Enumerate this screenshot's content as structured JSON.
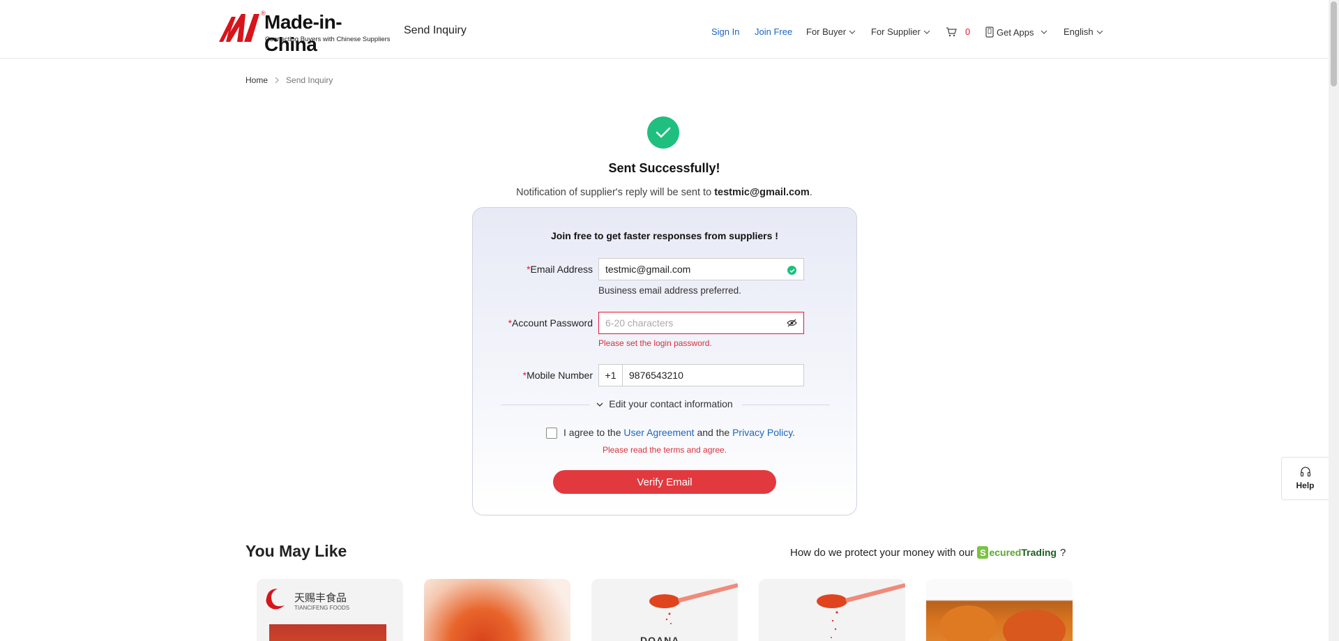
{
  "header": {
    "logo_text": "Made-in-China",
    "logo_reg": "®",
    "logo_tagline": "Connecting Buyers with Chinese Suppliers",
    "title": "Send Inquiry",
    "nav": {
      "sign_in": "Sign In",
      "join_free": "Join Free",
      "for_buyer": "For Buyer",
      "for_supplier": "For Supplier",
      "cart_count": "0",
      "get_apps": "Get Apps",
      "language": "English"
    }
  },
  "breadcrumb": {
    "home": "Home",
    "current": "Send Inquiry"
  },
  "success": {
    "title": "Sent Successfully!",
    "notify_prefix": "Notification of supplier's reply will be sent to ",
    "notify_email": "testmic@gmail.com",
    "notify_suffix": "."
  },
  "form": {
    "title": "Join free to get faster responses from suppliers !",
    "email_label": "Email Address",
    "email_value": "testmic@gmail.com",
    "email_hint": "Business email address preferred.",
    "password_label": "Account Password",
    "password_placeholder": "6-20 characters",
    "password_error": "Please set the login password.",
    "mobile_label": "Mobile Number",
    "country_code": "+1",
    "mobile_value": "9876543210",
    "edit_contact": "Edit your contact information",
    "agree_prefix": "I agree to the ",
    "user_agreement": "User Agreement",
    "agree_mid": " and the ",
    "privacy_policy": "Privacy Policy.",
    "agree_error": "Please read the terms and agree.",
    "verify_button": "Verify Email",
    "required_mark": "*"
  },
  "help": {
    "label": "Help"
  },
  "you_may_like": {
    "title": "You May Like",
    "protect_prefix": "How do we protect your money with our",
    "secured_s": "S",
    "secured_rest": "ecured",
    "trading": "Trading",
    "protect_suffix": "?",
    "brand_cn": "天赐丰食品",
    "brand_en": "TIANCIFENG FOODS",
    "brand_doana": "DOANA"
  },
  "colors": {
    "accent_red": "#e2393f",
    "link_blue": "#1a66c2",
    "success_green": "#1fbf7f",
    "error_red": "#d6303a"
  }
}
